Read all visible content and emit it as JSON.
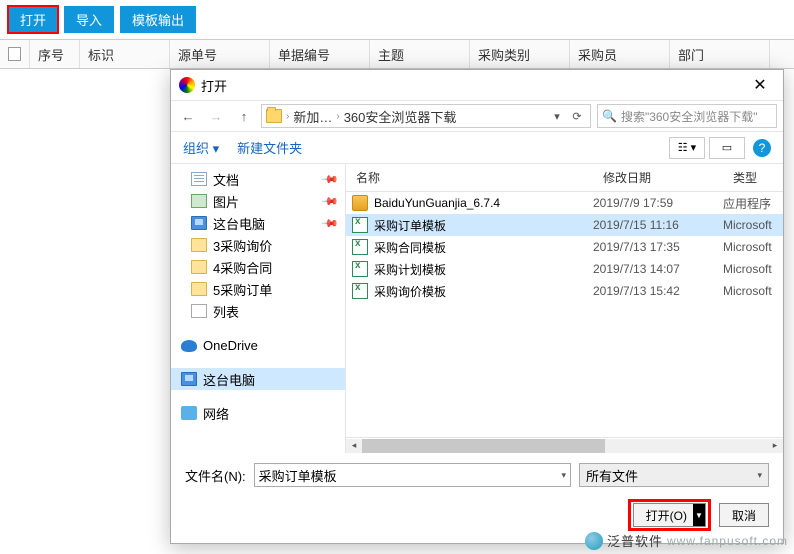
{
  "toolbar": {
    "open": "打开",
    "import": "导入",
    "template_export": "模板输出"
  },
  "grid": {
    "seq": "序号",
    "mark": "标识",
    "src": "源单号",
    "doc": "单据编号",
    "subj": "主题",
    "cat": "采购类别",
    "buyer": "采购员",
    "dept": "部门"
  },
  "dialog": {
    "title": "打开",
    "path": {
      "seg1": "新加…",
      "seg2": "360安全浏览器下载"
    },
    "search_placeholder": "搜索\"360安全浏览器下载\"",
    "organize": "组织",
    "new_folder": "新建文件夹",
    "columns": {
      "name": "名称",
      "date": "修改日期",
      "type": "类型"
    },
    "sidebar": [
      {
        "label": "文档",
        "icon": "docs",
        "pin": true
      },
      {
        "label": "图片",
        "icon": "pic",
        "pin": true
      },
      {
        "label": "这台电脑",
        "icon": "pc",
        "pin": true
      },
      {
        "label": "3采购询价",
        "icon": "folder"
      },
      {
        "label": "4采购合同",
        "icon": "folder"
      },
      {
        "label": "5采购订单",
        "icon": "folder"
      },
      {
        "label": "列表",
        "icon": "list"
      },
      {
        "label": "OneDrive",
        "icon": "cloud",
        "level0": true,
        "gapBefore": true
      },
      {
        "label": "这台电脑",
        "icon": "pc",
        "level0": true,
        "gapBefore": true,
        "selected": true
      },
      {
        "label": "网络",
        "icon": "net",
        "level0": true,
        "gapBefore": true
      }
    ],
    "files": [
      {
        "name": "BaiduYunGuanjia_6.7.4",
        "date": "2019/7/9 17:59",
        "type": "应用程序",
        "icon": "exe"
      },
      {
        "name": "采购订单模板",
        "date": "2019/7/15 11:16",
        "type": "Microsoft",
        "icon": "xls",
        "selected": true
      },
      {
        "name": "采购合同模板",
        "date": "2019/7/13 17:35",
        "type": "Microsoft",
        "icon": "xls"
      },
      {
        "name": "采购计划模板",
        "date": "2019/7/13 14:07",
        "type": "Microsoft",
        "icon": "xls"
      },
      {
        "name": "采购询价模板",
        "date": "2019/7/13 15:42",
        "type": "Microsoft",
        "icon": "xls"
      }
    ],
    "filename_label": "文件名(N):",
    "filename_value": "采购订单模板",
    "filter": "所有文件",
    "open_btn": "打开(O)",
    "cancel_btn": "取消"
  },
  "watermark": {
    "cn": "泛普软件",
    "url": "www.fanpusoft.com"
  }
}
